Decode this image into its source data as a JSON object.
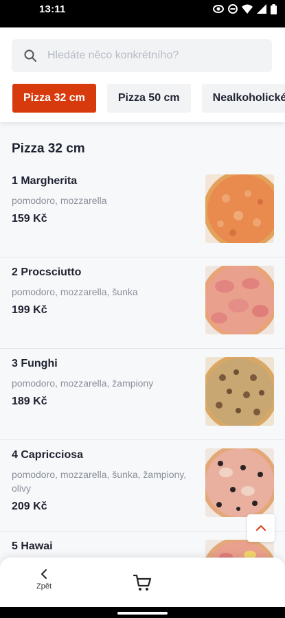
{
  "status": {
    "time": "13:11"
  },
  "search": {
    "placeholder": "Hledáte něco konkrétního?"
  },
  "tabs": [
    {
      "label": "Pizza 32 cm",
      "active": true
    },
    {
      "label": "Pizza 50 cm",
      "active": false
    },
    {
      "label": "Nealkoholické nápoje",
      "active": false
    }
  ],
  "section": {
    "title": "Pizza 32 cm"
  },
  "items": [
    {
      "name": "1 Margherita",
      "description": "pomodoro, mozzarella",
      "price": "159 Kč"
    },
    {
      "name": "2 Procsciutto",
      "description": "pomodoro, mozzarella, šunka",
      "price": "199 Kč"
    },
    {
      "name": "3 Funghi",
      "description": "pomodoro, mozzarella, žampiony",
      "price": "189 Kč"
    },
    {
      "name": "4 Capricciosa",
      "description": "pomodoro, mozzarella, šunka, žampiony, olivy",
      "price": "209 Kč"
    },
    {
      "name": "5 Hawai",
      "description": "",
      "price": ""
    }
  ],
  "bottom": {
    "back_label": "Zpět"
  },
  "colors": {
    "accent": "#d73a0c",
    "text": "#1f2230",
    "muted": "#8a8f99",
    "background": "#f7f8fa"
  }
}
